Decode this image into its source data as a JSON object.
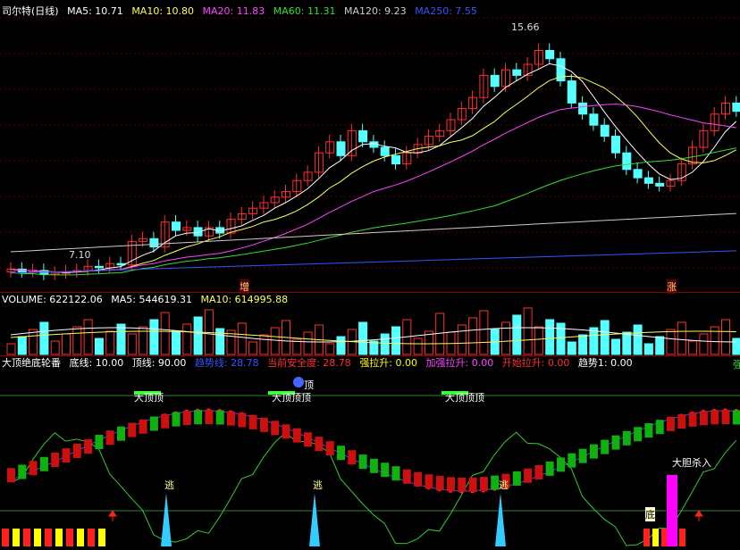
{
  "colors": {
    "bg": "#000000",
    "up": "#ff3030",
    "down": "#54ffff",
    "grid": "#8b0000",
    "ma5": "#ffffff",
    "ma10": "#ffff55",
    "ma20": "#ff44ff",
    "ma60": "#33dd33",
    "ma120": "#cccccc",
    "ma250": "#3355ff",
    "yellow": "#ffff00",
    "green": "#00ff00",
    "red": "#ff2020",
    "magenta": "#ff00ff",
    "cyan": "#33ccff"
  },
  "price_header": {
    "title": "司尔特(日线)",
    "ma5": "MA5: 10.71",
    "ma10": "MA10: 10.80",
    "ma20": "MA20: 11.83",
    "ma60": "MA60: 11.31",
    "ma120": "MA120: 9.23",
    "ma250": "MA250: 7.55"
  },
  "price_labels": {
    "high": "15.66",
    "low": "7.10",
    "mark1": "增",
    "mark2": "涨"
  },
  "volume_header": {
    "volume": "VOLUME: 622122.06",
    "ma5": "MA5: 544619.31",
    "ma10": "MA10: 614995.88"
  },
  "indicator_header": {
    "name": "大顶绝底轮番",
    "bottom_line": "底线: 10.00",
    "top_line": "顶线: 90.00",
    "trend_line": "趋势线: 28.78",
    "safety": "当前安全度: 28.78",
    "strong_up": "强拉升: 0.00",
    "plus_strong": "加强拉升: 0.00",
    "start_up": "开始拉升: 0.00",
    "trend1": "趋势1: 0.00",
    "cut": "强"
  },
  "indicator_labels": {
    "top1": "大顶顶",
    "top2": "大顶顶顶",
    "top3": "大顶顶顶",
    "top2_extra": "顶",
    "escape": "逃",
    "bottom": "底",
    "bold_buy": "大胆杀入",
    "small_bottom": "底"
  }
}
